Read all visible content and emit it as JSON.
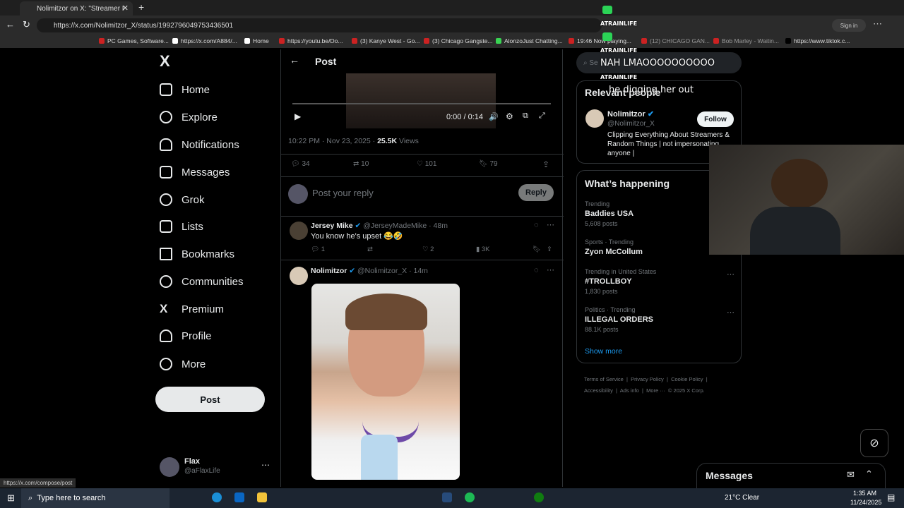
{
  "browser": {
    "tab_title": "Nolimitzor on X: \"Streamer I",
    "url": "https://x.com/Nolimitzor_X/status/1992796049753436501",
    "bookmarks": [
      "PC Games, Software...",
      "https://x.com/A884/...",
      "Home",
      "https://youtu.be/Do...",
      "(3) Kanye West - Go...",
      "(3) Chicago Gangste...",
      "AlonzoJust Chatting...",
      "19:46 Now playing...",
      "(12) CHICAGO GAN...",
      "Bob Marley - Waitin...",
      "https://www.tiktok.c..."
    ],
    "signin": "Sign in"
  },
  "nav": {
    "logo": "X",
    "items": [
      "Home",
      "Explore",
      "Notifications",
      "Messages",
      "Grok",
      "Lists",
      "Bookmarks",
      "Communities",
      "Premium",
      "Profile",
      "More"
    ],
    "post_label": "Post",
    "user_name": "Flax",
    "user_handle": "@aFlaxLife",
    "status_url": "https://x.com/compose/post"
  },
  "main": {
    "header": "Post",
    "video_time": "0:00 / 0:14",
    "timestamp": "10:22 PM · Nov 23, 2025 · ",
    "views_count": "25.5K",
    "views_label": " Views",
    "stats": {
      "replies": "34",
      "reposts": "10",
      "likes": "101",
      "bookmarks": "79"
    },
    "reply_placeholder": "Post your reply",
    "reply_button": "Reply",
    "reply1": {
      "name": "Jersey Mike",
      "handle": "@JerseyMadeMike · 48m",
      "text": "You know he's upset 😂🤣",
      "replies": "1",
      "likes": "2",
      "views": "3K"
    },
    "reply2": {
      "name": "Nolimitzor",
      "handle": "@Nolimitzor_X · 14m"
    }
  },
  "right": {
    "search": "Se",
    "relevant_title": "Relevant people",
    "person_name": "Nolimitzor",
    "person_handle": "@Nolimitzor_X",
    "person_bio": "Clipping Everything About Streamers & Random Things | not impersonating anyone |",
    "follow": "Follow",
    "happening_title": "What’s happening",
    "trends": [
      {
        "meta": "Trending",
        "name": "Baddies USA",
        "count": "5,608 posts"
      },
      {
        "meta": "Sports · Trending",
        "name": "Zyon McCollum",
        "count": ""
      },
      {
        "meta": "Trending in United States",
        "name": "#TROLLBOY",
        "count": "1,830 posts"
      },
      {
        "meta": "Politics · Trending",
        "name": "ILLEGAL ORDERS",
        "count": "88.1K posts"
      }
    ],
    "show_more": "Show more",
    "footer1": "Terms of Service  |  Privacy Policy  |  Cookie Policy  |",
    "footer2": "Accessibility  |  Ads info  |  More ···  © 2025 X Corp.",
    "messages": "Messages"
  },
  "overlay": {
    "user1": "ATRAINLIFE",
    "user2": "ATRAINLIFE",
    "msg2": "NAH LMAOOOOOOOOOO",
    "user3": "ATRAINLIFE",
    "msg3": "he digging her out"
  },
  "taskbar": {
    "search": "Type here to search",
    "weather": "21°C  Clear",
    "time": "1:35 AM",
    "date": "11/24/2025"
  }
}
